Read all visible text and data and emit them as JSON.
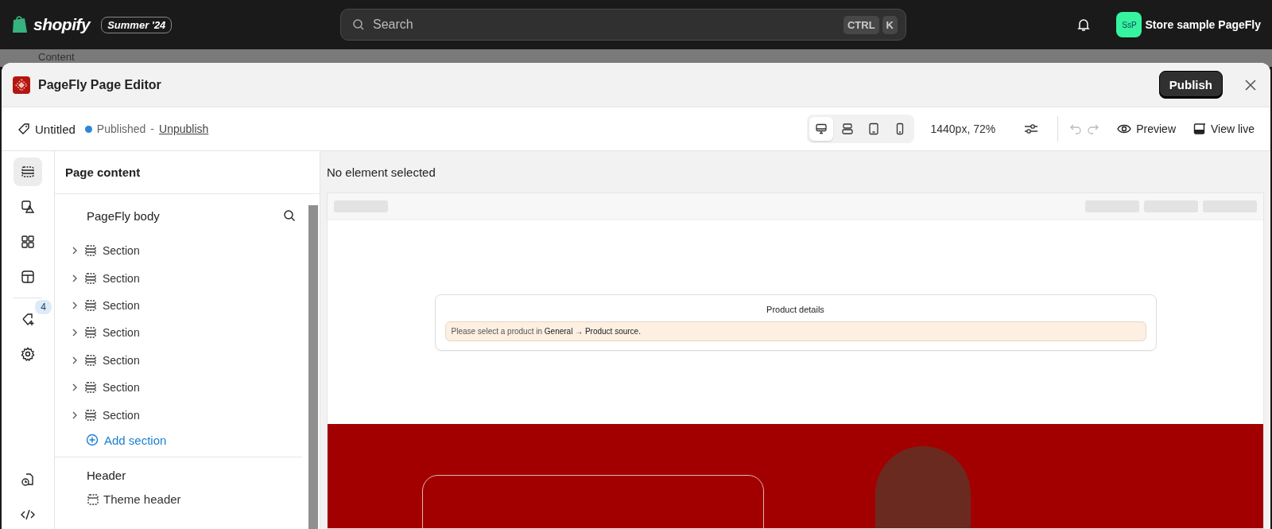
{
  "topbar": {
    "logo": "shopify",
    "edition": "Summer '24",
    "search": {
      "placeholder": "Search",
      "keys": [
        "CTRL",
        "K"
      ]
    },
    "store": {
      "initials": "SsP",
      "name": "Store sample PageFly"
    }
  },
  "background_nav": {
    "label": "Content"
  },
  "editor": {
    "title": "PageFly Page Editor",
    "publish": "Publish"
  },
  "toolbar": {
    "page_name": "Untitled",
    "status": "Published",
    "separator": "-",
    "unpublish": "Unpublish",
    "devices": [
      {
        "kind": "desktop",
        "selected": true
      },
      {
        "kind": "laptop",
        "selected": false
      },
      {
        "kind": "tablet",
        "selected": false
      },
      {
        "kind": "mobile",
        "selected": false
      }
    ],
    "viewport": "1440px, 72%",
    "preview": "Preview",
    "view_live": "View live"
  },
  "rail": {
    "items": [
      {
        "kind": "sections",
        "selected": true
      },
      {
        "kind": "media",
        "selected": false
      },
      {
        "kind": "grid",
        "selected": false
      },
      {
        "kind": "layout",
        "selected": false
      },
      {
        "kind": "addons",
        "selected": false,
        "badge": "4"
      },
      {
        "kind": "settings",
        "selected": false
      },
      {
        "kind": "history",
        "selected": false
      },
      {
        "kind": "code",
        "selected": false
      }
    ]
  },
  "panel": {
    "title": "Page content",
    "body_label": "PageFly body",
    "sections": [
      {
        "label": "Section",
        "expanded": false
      },
      {
        "label": "Section",
        "expanded": false
      },
      {
        "label": "Section",
        "expanded": false
      },
      {
        "label": "Section",
        "expanded": false
      },
      {
        "label": "Section",
        "expanded": false
      },
      {
        "label": "Section",
        "expanded": false
      },
      {
        "label": "Section",
        "expanded": false
      }
    ],
    "add_section": "Add section",
    "header_label": "Header",
    "header_item": "Theme header"
  },
  "canvas": {
    "status": "No element selected",
    "product_title": "Product details",
    "notice": "Please select a product in **General → Product source.**"
  }
}
